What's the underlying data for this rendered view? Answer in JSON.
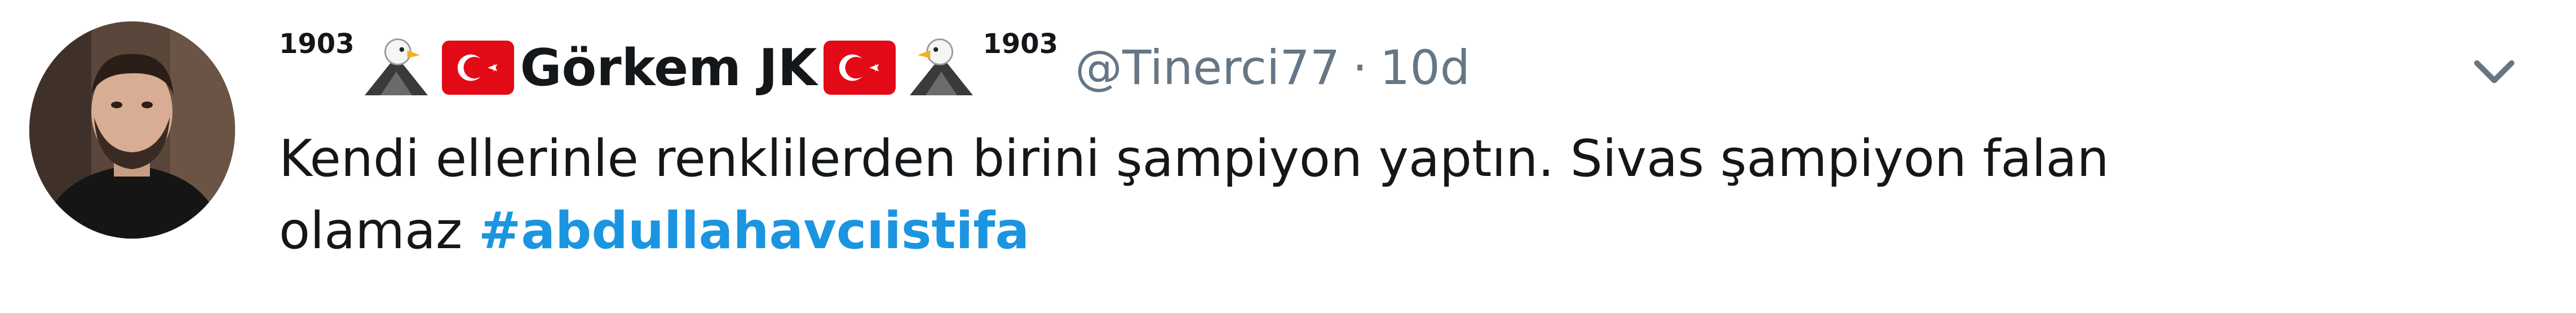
{
  "tweet": {
    "author": {
      "name_prefix": "1903",
      "display_name": "Görkem JK",
      "name_suffix": "1903",
      "handle": "@Tinerci77"
    },
    "separator": "·",
    "timestamp": "10d",
    "text_line1": "Kendi ellerinle renklilerden birini şampiyon yaptın. Sivas şampiyon falan",
    "text_line2_prefix": "olamaz ",
    "hashtag": "#abdullahavcıistifa"
  },
  "icons": {
    "left_emoji_1": "eagle-icon",
    "left_emoji_2": "turkey-flag-icon",
    "right_emoji_1": "turkey-flag-icon",
    "right_emoji_2": "eagle-icon",
    "menu": "chevron-down-icon"
  },
  "colors": {
    "text": "#14171a",
    "secondary": "#657786",
    "hashtag": "#1b95e0",
    "flag_red": "#e30a17"
  }
}
